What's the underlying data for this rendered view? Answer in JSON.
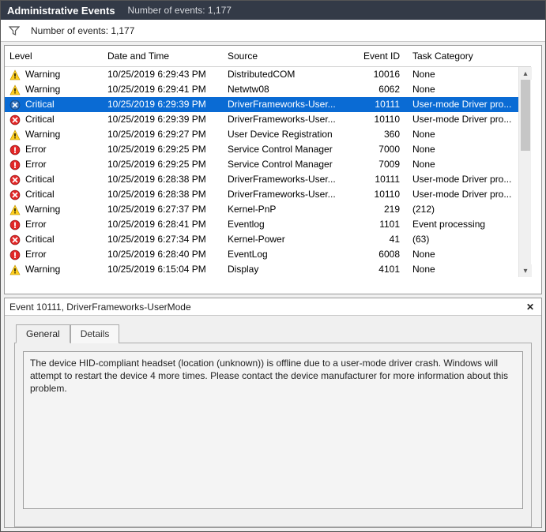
{
  "titlebar": {
    "main": "Administrative Events",
    "sub": "Number of events: 1,177"
  },
  "filterbar": {
    "count": "Number of events: 1,177"
  },
  "columns": {
    "level": "Level",
    "date": "Date and Time",
    "source": "Source",
    "id": "Event ID",
    "category": "Task Category"
  },
  "rows": [
    {
      "icon": "warning",
      "level": "Warning",
      "date": "10/25/2019 6:29:43 PM",
      "source": "DistributedCOM",
      "id": "10016",
      "category": "None"
    },
    {
      "icon": "warning",
      "level": "Warning",
      "date": "10/25/2019 6:29:41 PM",
      "source": "Netwtw08",
      "id": "6062",
      "category": "None"
    },
    {
      "icon": "critical-blue",
      "level": "Critical",
      "date": "10/25/2019 6:29:39 PM",
      "source": "DriverFrameworks-User...",
      "id": "10111",
      "category": "User-mode Driver pro...",
      "selected": true
    },
    {
      "icon": "critical",
      "level": "Critical",
      "date": "10/25/2019 6:29:39 PM",
      "source": "DriverFrameworks-User...",
      "id": "10110",
      "category": "User-mode Driver pro..."
    },
    {
      "icon": "warning",
      "level": "Warning",
      "date": "10/25/2019 6:29:27 PM",
      "source": "User Device Registration",
      "id": "360",
      "category": "None"
    },
    {
      "icon": "error",
      "level": "Error",
      "date": "10/25/2019 6:29:25 PM",
      "source": "Service Control Manager",
      "id": "7000",
      "category": "None"
    },
    {
      "icon": "error",
      "level": "Error",
      "date": "10/25/2019 6:29:25 PM",
      "source": "Service Control Manager",
      "id": "7009",
      "category": "None"
    },
    {
      "icon": "critical",
      "level": "Critical",
      "date": "10/25/2019 6:28:38 PM",
      "source": "DriverFrameworks-User...",
      "id": "10111",
      "category": "User-mode Driver pro..."
    },
    {
      "icon": "critical",
      "level": "Critical",
      "date": "10/25/2019 6:28:38 PM",
      "source": "DriverFrameworks-User...",
      "id": "10110",
      "category": "User-mode Driver pro..."
    },
    {
      "icon": "warning",
      "level": "Warning",
      "date": "10/25/2019 6:27:37 PM",
      "source": "Kernel-PnP",
      "id": "219",
      "category": "(212)"
    },
    {
      "icon": "error",
      "level": "Error",
      "date": "10/25/2019 6:28:41 PM",
      "source": "Eventlog",
      "id": "1101",
      "category": "Event processing"
    },
    {
      "icon": "critical",
      "level": "Critical",
      "date": "10/25/2019 6:27:34 PM",
      "source": "Kernel-Power",
      "id": "41",
      "category": "(63)"
    },
    {
      "icon": "error",
      "level": "Error",
      "date": "10/25/2019 6:28:40 PM",
      "source": "EventLog",
      "id": "6008",
      "category": "None"
    },
    {
      "icon": "warning",
      "level": "Warning",
      "date": "10/25/2019 6:15:04 PM",
      "source": "Display",
      "id": "4101",
      "category": "None"
    }
  ],
  "detail": {
    "header": "Event 10111, DriverFrameworks-UserMode",
    "tabs": {
      "general": "General",
      "details": "Details"
    },
    "description": "The device HID-compliant headset (location (unknown)) is offline due to a user-mode driver crash.  Windows will attempt to restart the device 4 more times.  Please contact the device manufacturer for more information about this problem."
  }
}
